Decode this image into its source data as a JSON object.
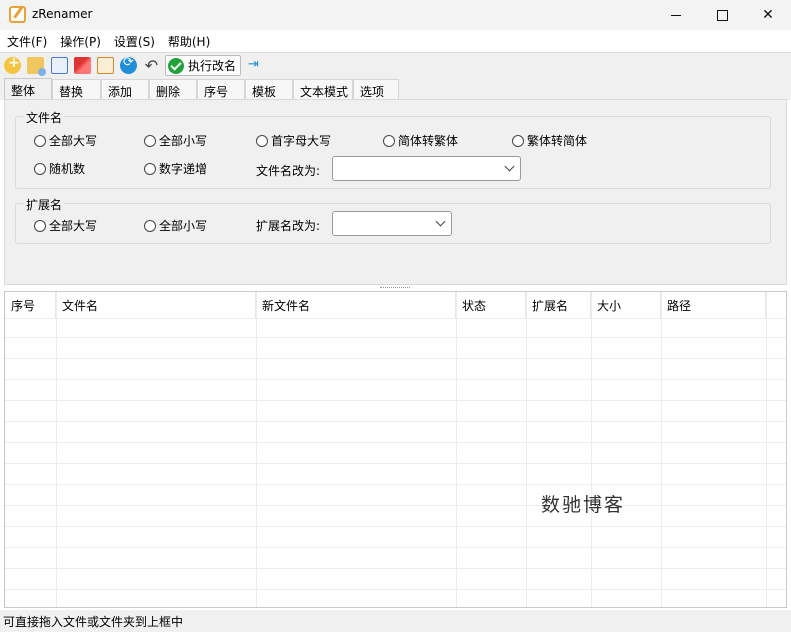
{
  "window": {
    "title": "zRenamer"
  },
  "menu": [
    "文件(F)",
    "操作(P)",
    "设置(S)",
    "帮助(H)"
  ],
  "toolbar": {
    "execute_label": "执行改名"
  },
  "tabs": [
    "整体",
    "替换",
    "添加",
    "删除",
    "序号",
    "模板",
    "文本模式",
    "选项"
  ],
  "filename_group": {
    "label": "文件名",
    "options": [
      "全部大写",
      "全部小写",
      "首字母大写",
      "简体转繁体",
      "繁体转简体",
      "随机数",
      "数字递增"
    ],
    "rename_label": "文件名改为:",
    "rename_value": ""
  },
  "ext_group": {
    "label": "扩展名",
    "options": [
      "全部大写",
      "全部小写"
    ],
    "rename_label": "扩展名改为:",
    "rename_value": ""
  },
  "table": {
    "columns": [
      "序号",
      "文件名",
      "新文件名",
      "状态",
      "扩展名",
      "大小",
      "路径"
    ]
  },
  "watermark": "数驰博客",
  "status": "可直接拖入文件或文件夹到上框中"
}
